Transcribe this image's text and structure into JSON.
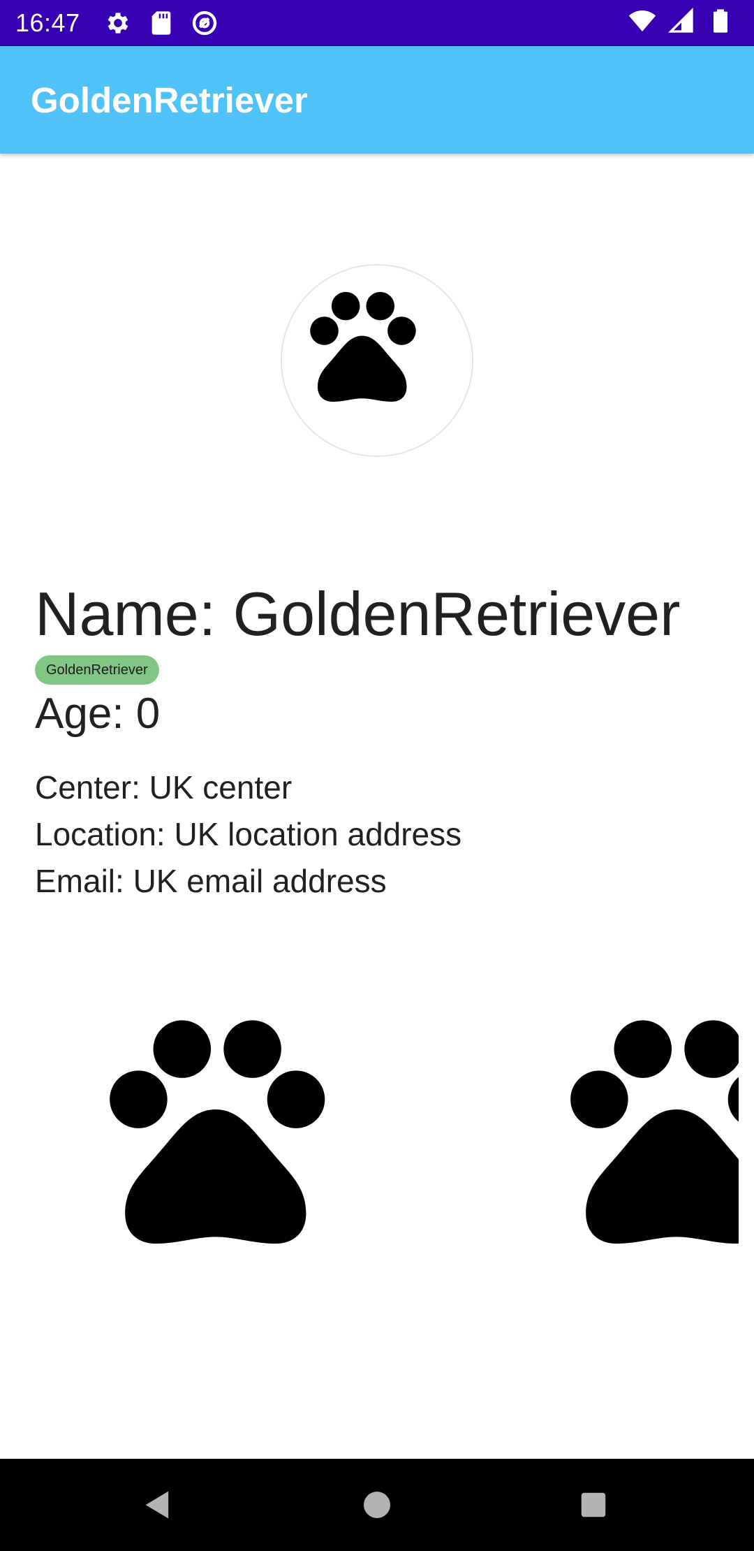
{
  "status_bar": {
    "time": "16:47",
    "left_icons": [
      "gear-icon",
      "sd-card-icon",
      "sync-icon"
    ],
    "right_icons": [
      "wifi-icon",
      "signal-icon",
      "battery-icon"
    ],
    "background": "#3700b3"
  },
  "app_bar": {
    "title": "GoldenRetriever",
    "background": "#4fc3f7"
  },
  "profile": {
    "avatar_icon": "paw-icon",
    "name_line": "Name: GoldenRetriever",
    "breed_chip": "GoldenRetriever",
    "chip_color": "#81c784",
    "age_line": "Age: 0",
    "center_line": "Center: UK center",
    "location_line": "Location: UK location address",
    "email_line": "Email: UK email address"
  },
  "gallery": {
    "images": [
      "paw-icon",
      "paw-icon"
    ]
  },
  "nav_bar": {
    "buttons": [
      "back-icon",
      "home-icon",
      "recents-icon"
    ]
  }
}
